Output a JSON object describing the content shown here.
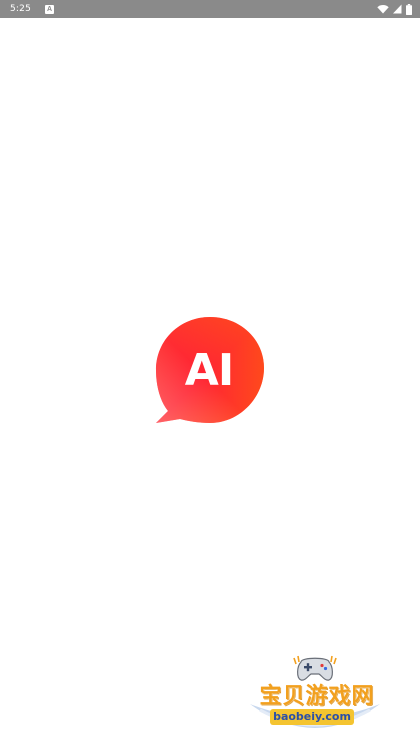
{
  "status_bar": {
    "time": "5:25",
    "notification_icon_label": "A",
    "icons": [
      "wifi-icon",
      "cell-signal-icon",
      "battery-icon"
    ]
  },
  "splash": {
    "logo_text": "AI",
    "logo_gradient": [
      "#ff9a8a",
      "#ff2a2a",
      "#ff6a00"
    ]
  },
  "watermark": {
    "title": "宝贝游戏网",
    "domain": "baobeiy.com",
    "title_color": "#f2a01e",
    "domain_bg": "#f4c430",
    "domain_color": "#2a4fa8"
  }
}
